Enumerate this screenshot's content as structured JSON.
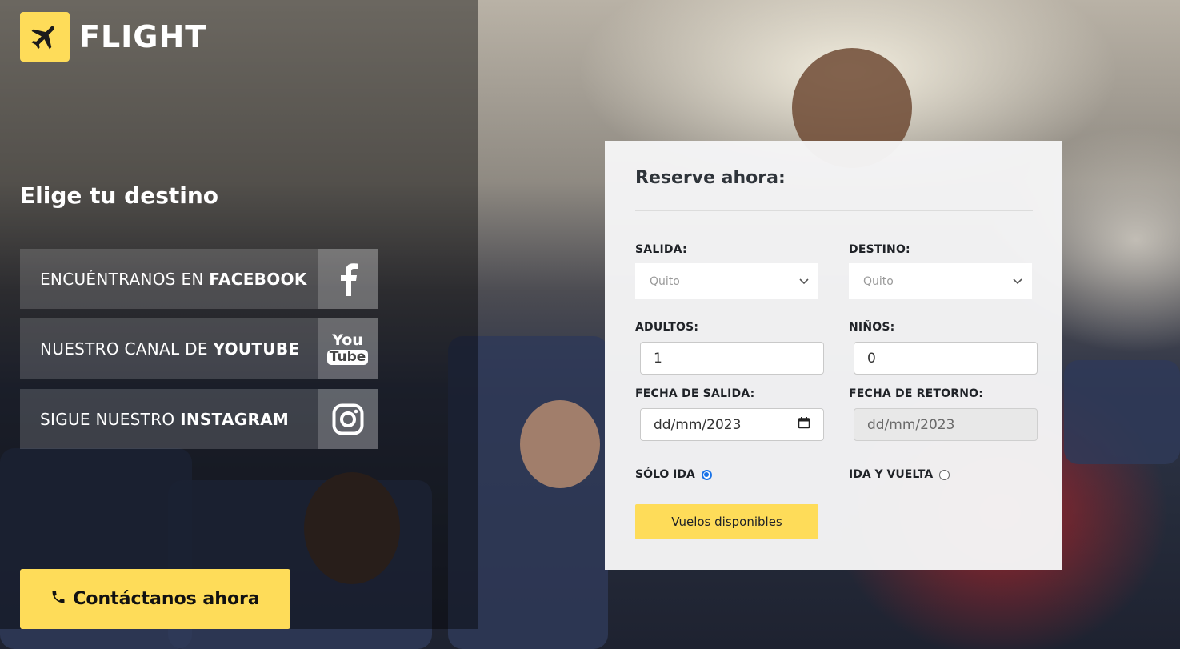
{
  "brand": {
    "name": "FLIGHT",
    "accent": "#fedc59",
    "icon": "airplane-icon"
  },
  "left": {
    "heading": "Elige tu destino",
    "social": [
      {
        "prefix": "ENCUÉNTRANOS EN ",
        "bold": "FACEBOOK",
        "icon": "facebook-icon"
      },
      {
        "prefix": "NUESTRO CANAL DE ",
        "bold": "YOUTUBE",
        "icon": "youtube-icon",
        "icon_top": "You",
        "icon_bottom": "Tube"
      },
      {
        "prefix": "SIGUE NUESTRO ",
        "bold": "INSTAGRAM",
        "icon": "instagram-icon"
      }
    ],
    "contact_label": "Contáctanos ahora",
    "contact_icon": "phone-icon"
  },
  "booking": {
    "title": "Reserve ahora:",
    "salida_label": "SALIDA:",
    "salida_value": "Quito",
    "destino_label": "DESTINO:",
    "destino_value": "Quito",
    "adultos_label": "ADULTOS:",
    "adultos_value": "1",
    "ninos_label": "NIÑOS:",
    "ninos_value": "0",
    "fecha_salida_label": "FECHA DE SALIDA:",
    "fecha_salida_value": "dd/mm/2023",
    "fecha_retorno_label": "FECHA DE RETORNO:",
    "fecha_retorno_value": "dd/mm/2023",
    "solo_ida_label": "SÓLO IDA",
    "ida_vuelta_label": "IDA Y VUELTA",
    "trip_type_selected": "SÓLO IDA",
    "submit_label": "Vuelos disponibles"
  }
}
